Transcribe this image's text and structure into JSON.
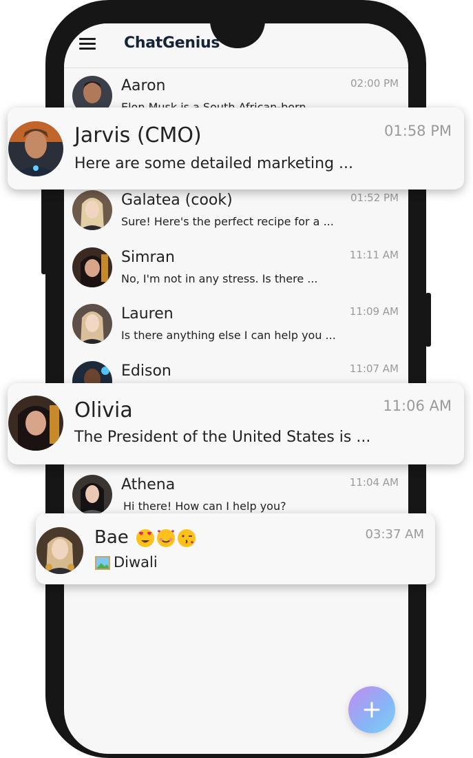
{
  "app": {
    "title": "ChatGenius",
    "colors": {
      "accent": "#152238",
      "fab_gradient_start": "#c48af0",
      "fab_gradient_end": "#7fd0f8",
      "time_text": "#9a9a9a"
    }
  },
  "chats": [
    {
      "name": "Aaron",
      "message": "Elon Musk is a South African-born",
      "time": "02:00 PM"
    },
    {
      "name": "Jarvis (CMO)",
      "message": "Here are some detailed marketing ...",
      "time": "01:58 PM"
    },
    {
      "name": "Galatea (cook)",
      "message": "Sure! Here's the perfect recipe for a ...",
      "time": "01:52 PM"
    },
    {
      "name": "Simran",
      "message": "No, I'm not in any stress. Is there ...",
      "time": "11:11 AM"
    },
    {
      "name": "Lauren",
      "message": "Is there anything else I can help you ...",
      "time": "11:09 AM"
    },
    {
      "name": "Edison",
      "message": "",
      "time": "11:07 AM"
    },
    {
      "name": "Olivia",
      "message": "The President of the United States is ...",
      "time": "11:06 AM"
    },
    {
      "name": "Athena",
      "message": "Hi there! How can I help you?",
      "time": "11:04 AM"
    },
    {
      "name": "Bae",
      "message": "Diwali",
      "time": "03:37 AM",
      "name_emojis": [
        "heart-eyes-emoji",
        "smiling-hearts-emoji",
        "kissing-heart-emoji"
      ],
      "message_icon": "photo-icon"
    }
  ],
  "fab": {
    "icon": "plus-icon"
  }
}
